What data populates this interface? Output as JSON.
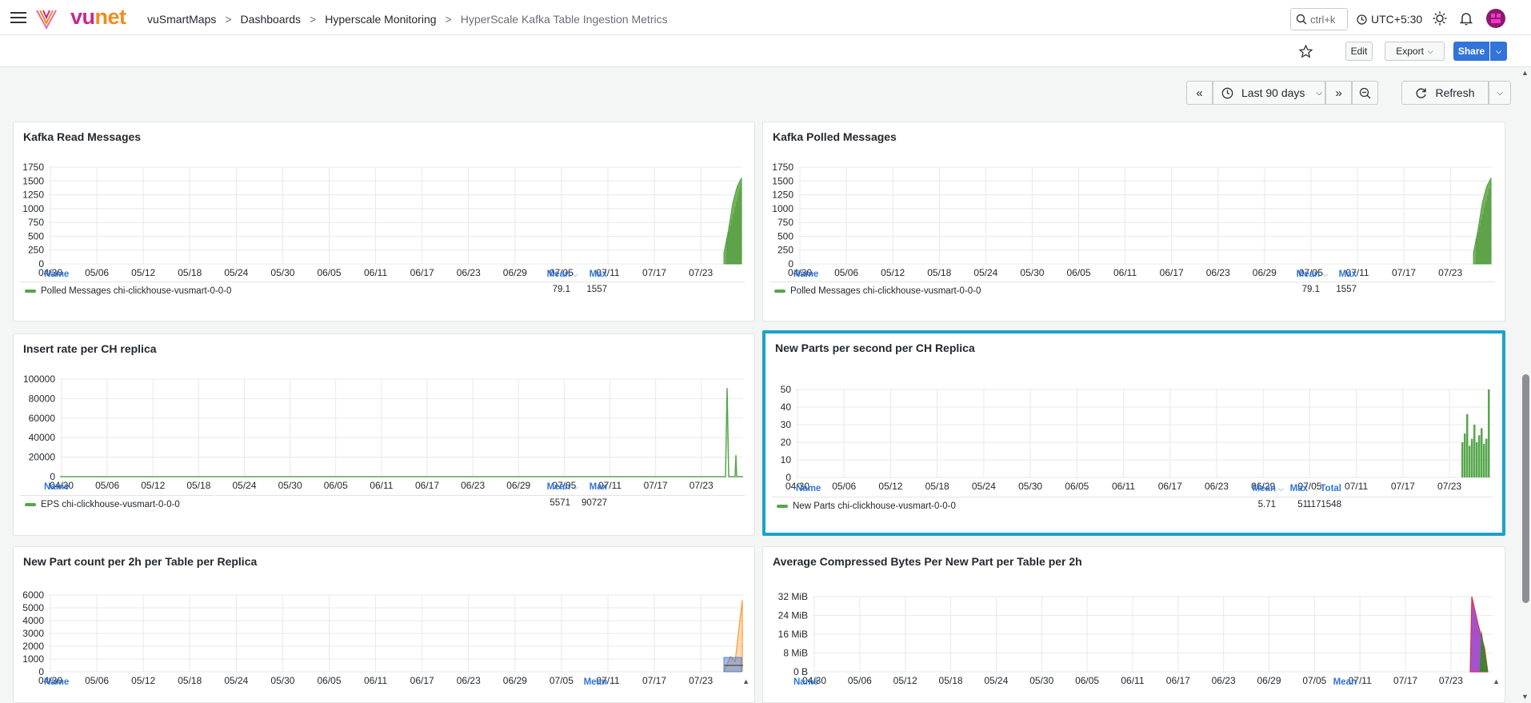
{
  "header": {
    "brand_prefix": "vu",
    "brand_suffix": "net",
    "breadcrumbs": [
      "vuSmartMaps",
      "Dashboards",
      "Hyperscale Monitoring",
      "HyperScale Kafka Table Ingestion Metrics"
    ],
    "breadcrumb_sep": ">",
    "search_placeholder": "ctrl+k",
    "timezone": "UTC+5:30",
    "icons": [
      "menu-icon",
      "search-icon",
      "clock-icon",
      "sun-icon",
      "bell-icon",
      "avatar"
    ]
  },
  "toolbar": {
    "edit_label": "Edit",
    "export_label": "Export",
    "share_label": "Share"
  },
  "timepicker": {
    "range_label": "Last 90 days",
    "refresh_label": "Refresh"
  },
  "colors": {
    "accent": "#3274d9",
    "selected": "#1aa2c9",
    "series_green": "#56a64b",
    "brand_magenta": "#c8288c",
    "brand_orange": "#f08c1e"
  },
  "x_ticks": [
    "04/30",
    "05/06",
    "05/12",
    "05/18",
    "05/24",
    "05/30",
    "06/05",
    "06/11",
    "06/17",
    "06/23",
    "06/29",
    "07/05",
    "07/11",
    "07/17",
    "07/23"
  ],
  "panels": [
    {
      "title": "Kafka Read Messages",
      "y_ticks": [
        "1750",
        "1500",
        "1250",
        "1000",
        "750",
        "500",
        "250",
        "0"
      ],
      "legend": {
        "name_header": "Name",
        "columns": [
          "Mean",
          "Max"
        ],
        "rows": [
          {
            "name": "Polled Messages chi-clickhouse-vusmart-0-0-0",
            "values": [
              "79.1",
              "1557"
            ]
          }
        ]
      }
    },
    {
      "title": "Kafka Polled Messages",
      "y_ticks": [
        "1750",
        "1500",
        "1250",
        "1000",
        "750",
        "500",
        "250",
        "0"
      ],
      "legend": {
        "name_header": "Name",
        "columns": [
          "Mean",
          "Max"
        ],
        "rows": [
          {
            "name": "Polled Messages chi-clickhouse-vusmart-0-0-0",
            "values": [
              "79.1",
              "1557"
            ]
          }
        ]
      }
    },
    {
      "title": "Insert rate per CH replica",
      "y_ticks": [
        "100000",
        "80000",
        "60000",
        "40000",
        "20000",
        "0"
      ],
      "legend": {
        "name_header": "Name",
        "columns": [
          "Mean",
          "Max"
        ],
        "rows": [
          {
            "name": "EPS chi-clickhouse-vusmart-0-0-0",
            "values": [
              "5571",
              "90727"
            ]
          }
        ]
      }
    },
    {
      "title": "New Parts per second per CH Replica",
      "y_ticks": [
        "50",
        "40",
        "30",
        "20",
        "10",
        "0"
      ],
      "legend": {
        "name_header": "Name",
        "columns": [
          "Mean",
          "Max",
          "Total"
        ],
        "rows": [
          {
            "name": "New Parts chi-clickhouse-vusmart-0-0-0",
            "values": [
              "5.71",
              "51",
              "1171548"
            ]
          }
        ]
      }
    },
    {
      "title": "New Part count per 2h per Table per Replica",
      "y_ticks": [
        "6000",
        "5000",
        "4000",
        "3000",
        "2000",
        "1000",
        "0"
      ],
      "legend": {
        "name_header": "Name",
        "columns": [
          "Mean"
        ],
        "rows": []
      }
    },
    {
      "title": "Average Compressed Bytes Per New Part per Table per 2h",
      "y_ticks": [
        "32 MiB",
        "24 MiB",
        "16 MiB",
        "8 MiB",
        "0 B"
      ],
      "legend": {
        "name_header": "Name",
        "columns": [
          "Mean"
        ],
        "rows": []
      }
    }
  ],
  "chart_data": [
    {
      "type": "area",
      "title": "Kafka Read Messages",
      "x": [
        "04/30",
        "05/06",
        "05/12",
        "05/18",
        "05/24",
        "05/30",
        "06/05",
        "06/11",
        "06/17",
        "06/23",
        "06/29",
        "07/05",
        "07/11",
        "07/17",
        "07/23"
      ],
      "ylim": [
        0,
        1750
      ],
      "series": [
        {
          "name": "Polled Messages chi-clickhouse-vusmart-0-0-0",
          "values": [
            0,
            0,
            0,
            0,
            0,
            0,
            0,
            0,
            0,
            0,
            0,
            0,
            0,
            0,
            0,
            200,
            600,
            1100,
            1400,
            1557
          ]
        }
      ]
    },
    {
      "type": "area",
      "title": "Kafka Polled Messages",
      "ylim": [
        0,
        1750
      ],
      "series": [
        {
          "name": "Polled Messages chi-clickhouse-vusmart-0-0-0",
          "values": [
            0,
            0,
            0,
            0,
            0,
            0,
            0,
            0,
            0,
            0,
            0,
            0,
            0,
            0,
            0,
            200,
            600,
            1100,
            1400,
            1557
          ]
        }
      ]
    },
    {
      "type": "line",
      "title": "Insert rate per CH replica",
      "ylim": [
        0,
        100000
      ],
      "series": [
        {
          "name": "EPS chi-clickhouse-vusmart-0-0-0",
          "values": [
            0,
            0,
            0,
            0,
            0,
            0,
            0,
            0,
            0,
            0,
            0,
            0,
            0,
            0,
            0,
            90727,
            0,
            22000,
            0,
            0
          ]
        }
      ]
    },
    {
      "type": "bar",
      "title": "New Parts per second per CH Replica",
      "ylim": [
        0,
        50
      ],
      "series": [
        {
          "name": "New Parts chi-clickhouse-vusmart-0-0-0",
          "values": [
            20,
            25,
            36,
            18,
            22,
            30,
            20,
            24,
            28,
            19,
            22,
            51
          ]
        }
      ]
    },
    {
      "type": "line",
      "title": "New Part count per 2h per Table per Replica",
      "ylim": [
        0,
        6000
      ],
      "series": [
        {
          "values": [
            0,
            800,
            1200,
            600,
            5600
          ]
        }
      ]
    },
    {
      "type": "area",
      "title": "Average Compressed Bytes Per New Part per Table per 2h",
      "ylim": [
        0,
        32
      ],
      "series": [
        {
          "values": [
            0,
            35,
            20,
            10,
            0
          ]
        }
      ]
    }
  ]
}
